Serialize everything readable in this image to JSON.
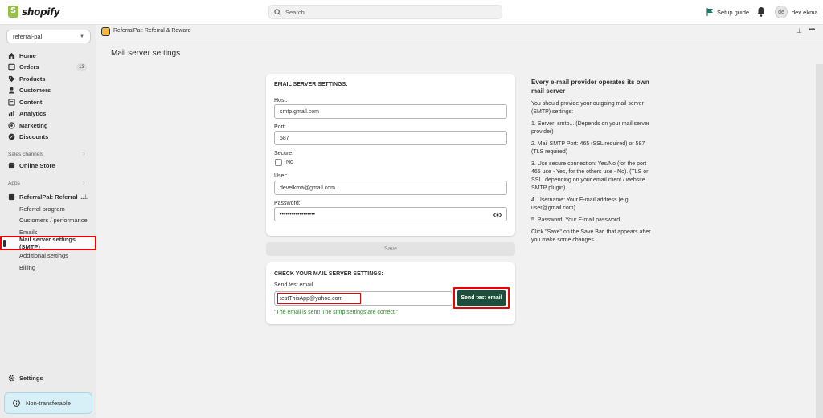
{
  "topbar": {
    "brand": "shopify",
    "search_placeholder": "Search",
    "setup_guide": "Setup guide",
    "user_initials": "de",
    "user_name": "dev ekma"
  },
  "sidebar": {
    "store": "referral-pal",
    "nav": [
      {
        "label": "Home",
        "icon": "home-icon"
      },
      {
        "label": "Orders",
        "icon": "orders-icon",
        "badge": "13"
      },
      {
        "label": "Products",
        "icon": "tag-icon"
      },
      {
        "label": "Customers",
        "icon": "person-icon"
      },
      {
        "label": "Content",
        "icon": "content-icon"
      },
      {
        "label": "Analytics",
        "icon": "chart-icon"
      },
      {
        "label": "Marketing",
        "icon": "target-icon"
      },
      {
        "label": "Discounts",
        "icon": "discount-icon"
      }
    ],
    "sales_channels_label": "Sales channels",
    "online_store": "Online Store",
    "apps_label": "Apps",
    "app_name": "ReferralPal: Referral ...",
    "app_sub_items": [
      "Referral program",
      "Customers / performance",
      "Emails",
      "Mail server settings (SMTP)",
      "Additional settings",
      "Billing"
    ],
    "settings": "Settings",
    "non_transferable": "Non-transferable"
  },
  "app_header": {
    "title": "ReferralPal: Referral & Reward"
  },
  "page": {
    "title": "Mail server settings"
  },
  "smtp_form": {
    "heading": "EMAIL SERVER SETTINGS:",
    "host_label": "Host:",
    "host_value": "smtp.gmail.com",
    "port_label": "Port:",
    "port_value": "587",
    "secure_label": "Secure:",
    "secure_option": "No",
    "user_label": "User:",
    "user_value": "develkma@gmail.com",
    "password_label": "Password:",
    "password_value": "••••••••••••••••••",
    "save_label": "Save"
  },
  "test_form": {
    "heading": "CHECK YOUR MAIL SERVER SETTINGS:",
    "field_label": "Send test email",
    "email_value": "testThisApp@yahoo.com",
    "button_label": "Send test email",
    "success_message": "\"The email is sent! The smtp settings are correct.\""
  },
  "help": {
    "title": "Every e-mail provider operates its own mail server",
    "paragraphs": [
      "You should provide your outgoing mail server (SMTP) settings:",
      "1. Server: smtp... (Depends on your mail server provider)",
      "2. Mail SMTP Port: 465 (SSL required) or 587 (TLS required)",
      "3. Use secure connection: Yes/No (for the port 465 use - Yes, for the others use - No). (TLS or SSL, depending on your email client / website SMTP plugin).",
      "4. Username: Your E-mail address (e.g. user@gmail.com)",
      "5. Password: Your E-mail password",
      "Click \"Save\" on the Save Bar, that appears after you make some changes."
    ]
  },
  "colors": {
    "send_button": "#1e4d3c",
    "highlight": "#ee0000",
    "success": "#2e8b2e",
    "brand_green": "#95bf47"
  }
}
